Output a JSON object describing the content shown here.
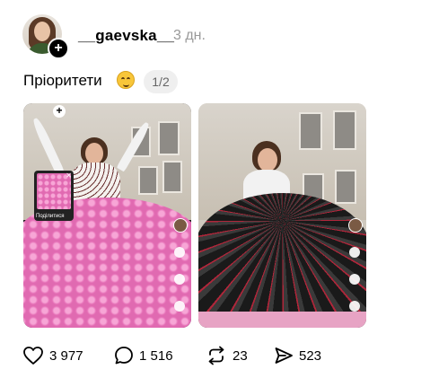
{
  "author": {
    "username": "__gaevska__",
    "time_ago": "3 дн."
  },
  "post": {
    "text": "Пріоритети",
    "emoji": "smirk-emoji",
    "media_counter": "1/2",
    "share_thumb_label": "Поділитися"
  },
  "stats": {
    "likes": "3 977",
    "comments": "1 516",
    "reposts": "23",
    "shares": "523"
  },
  "colors": {
    "muted_text": "#999999",
    "counter_bg": "#efefef",
    "roses_pink": "#e06ab1"
  }
}
